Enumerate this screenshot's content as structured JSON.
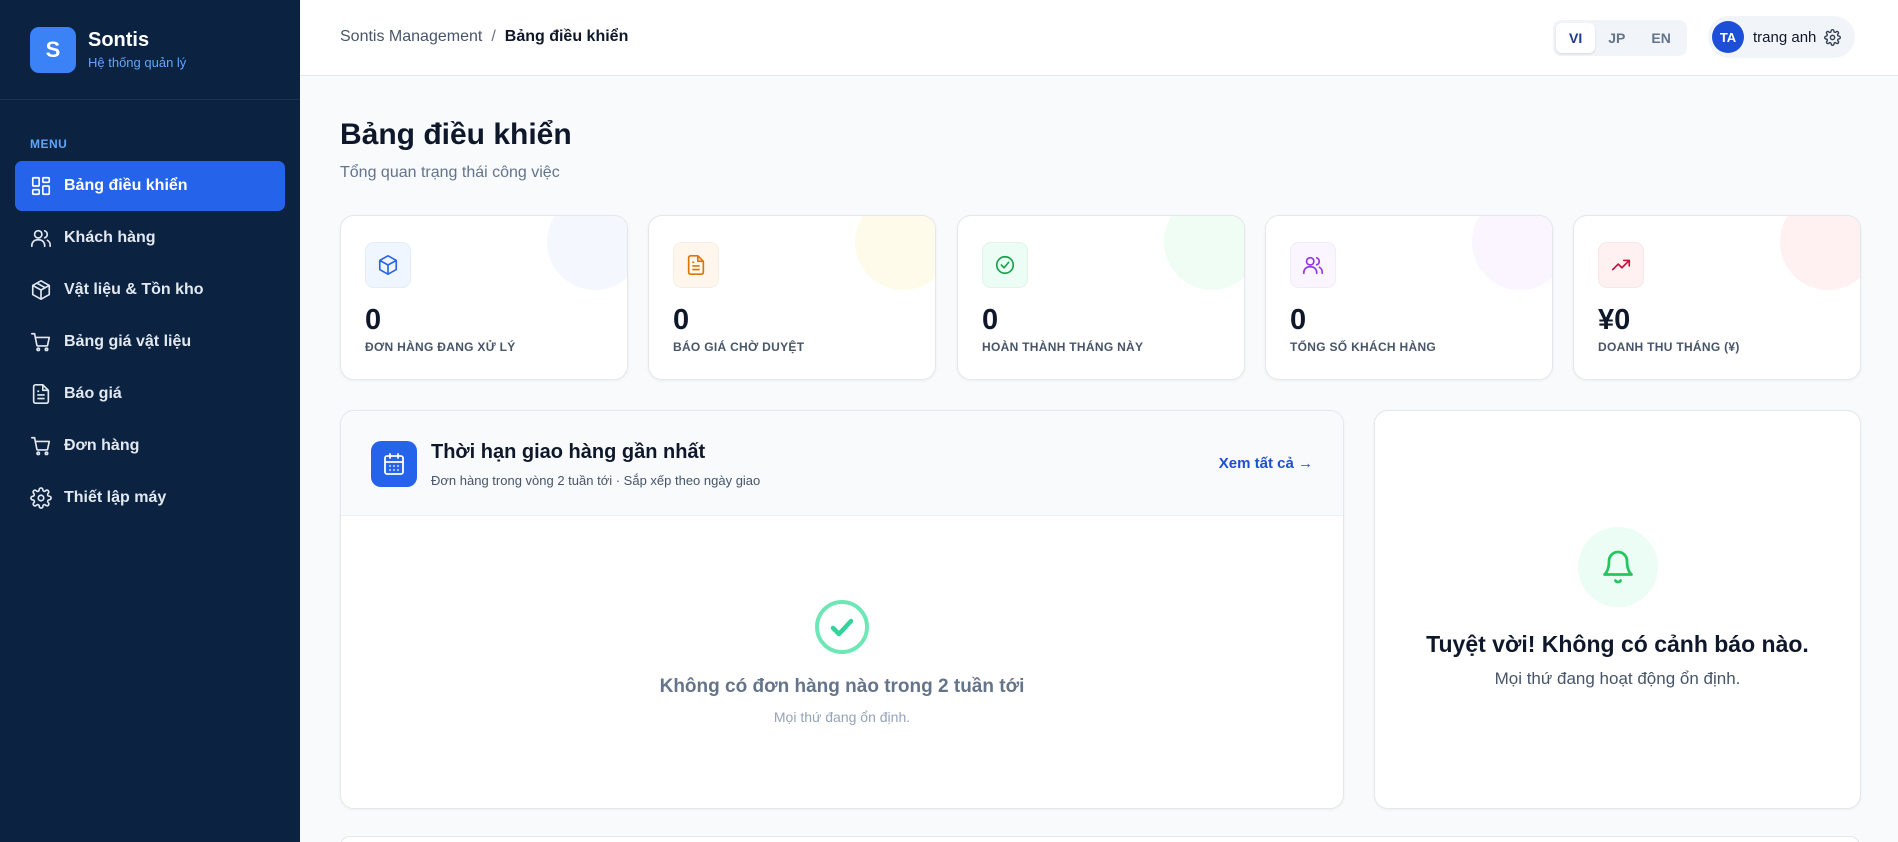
{
  "brand": {
    "logo_letter": "S",
    "name": "Sontis",
    "subtitle": "Hệ thống quản lý"
  },
  "sidebar": {
    "menu_title": "MENU",
    "items": [
      {
        "label": "Bảng điều khiển",
        "icon": "dashboard-icon",
        "active": true
      },
      {
        "label": "Khách hàng",
        "icon": "users-icon",
        "active": false
      },
      {
        "label": "Vật liệu & Tồn kho",
        "icon": "box-icon",
        "active": false
      },
      {
        "label": "Bảng giá vật liệu",
        "icon": "cart-icon",
        "active": false
      },
      {
        "label": "Báo giá",
        "icon": "document-icon",
        "active": false
      },
      {
        "label": "Đơn hàng",
        "icon": "cart-icon",
        "active": false
      },
      {
        "label": "Thiết lập máy",
        "icon": "gear-icon",
        "active": false
      }
    ]
  },
  "header": {
    "breadcrumb": {
      "root": "Sontis Management",
      "separator": "/",
      "current": "Bảng điều khiển"
    },
    "languages": [
      {
        "code": "VI",
        "active": true
      },
      {
        "code": "JP",
        "active": false
      },
      {
        "code": "EN",
        "active": false
      }
    ],
    "user": {
      "initials": "TA",
      "name": "trang anh"
    }
  },
  "page": {
    "title": "Bảng điều khiển",
    "subtitle": "Tổng quan trạng thái công việc"
  },
  "stats": [
    {
      "value": "0",
      "label": "ĐƠN HÀNG ĐANG XỬ LÝ",
      "icon": "box-icon",
      "color": "#2563eb",
      "tint": "#eff6ff",
      "deco": "#f5f7ff"
    },
    {
      "value": "0",
      "label": "BÁO GIÁ CHỜ DUYỆT",
      "icon": "document-icon",
      "color": "#d97706",
      "tint": "#fff7ed",
      "deco": "#fffbeb"
    },
    {
      "value": "0",
      "label": "HOÀN THÀNH THÁNG NÀY",
      "icon": "check-circle-icon",
      "color": "#16a34a",
      "tint": "#ecfdf5",
      "deco": "#f0fdf4"
    },
    {
      "value": "0",
      "label": "TỔNG SỐ KHÁCH HÀNG",
      "icon": "users-icon",
      "color": "#9333ea",
      "tint": "#faf5ff",
      "deco": "#faf5ff"
    },
    {
      "value": "¥0",
      "label": "DOANH THU THÁNG (¥)",
      "icon": "trending-up-icon",
      "color": "#be123c",
      "tint": "#fff1f2",
      "deco": "#fff1f2"
    }
  ],
  "deadlines": {
    "title": "Thời hạn giao hàng gần nhất",
    "subtitle": "Đơn hàng trong vòng 2 tuần tới · Sắp xếp theo ngày giao",
    "view_all": "Xem tất cả →",
    "empty_title": "Không có đơn hàng nào trong 2 tuần tới",
    "empty_subtitle": "Mọi thứ đang ổn định."
  },
  "alerts": {
    "title": "Tuyệt vời! Không có cảnh báo nào.",
    "subtitle": "Mọi thứ đang hoạt động ổn định."
  },
  "colors": {
    "sidebar_bg": "#0b2240",
    "accent": "#2563eb",
    "success": "#22c55e"
  }
}
